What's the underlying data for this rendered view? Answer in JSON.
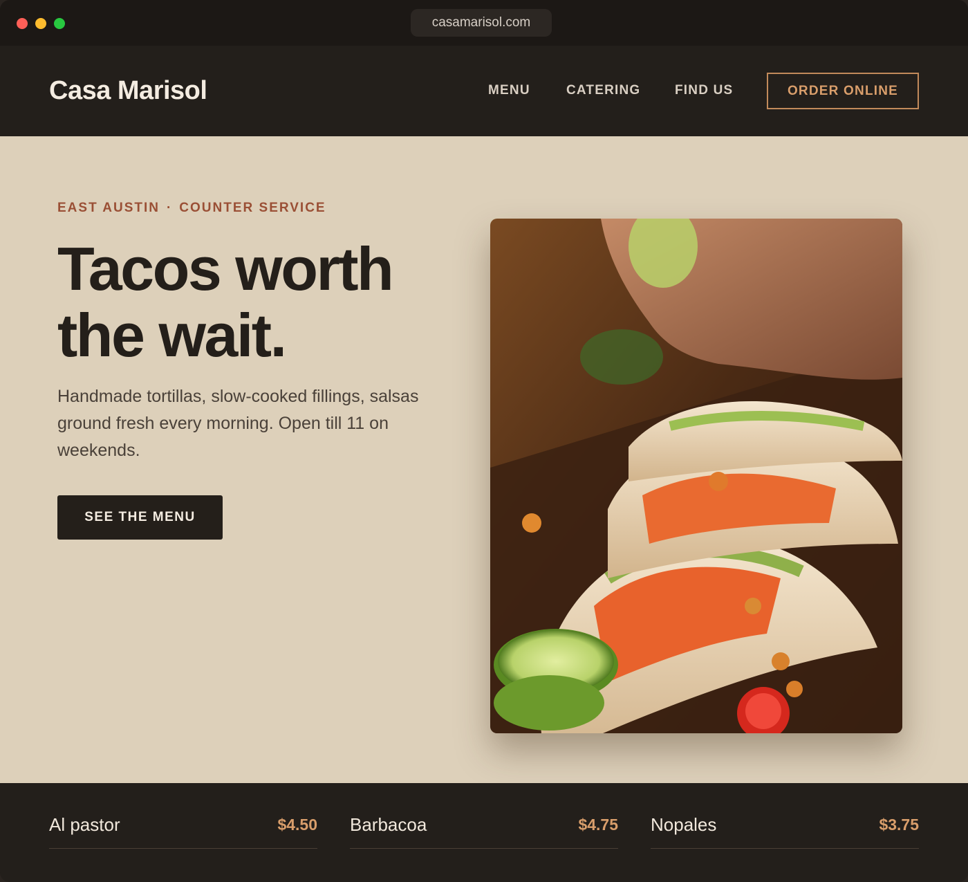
{
  "browser": {
    "url": "casamarisol.com"
  },
  "header": {
    "brand": "Casa Marisol",
    "nav": {
      "menu": "MENU",
      "catering": "CATERING",
      "find_us": "FIND US"
    },
    "order_button": "ORDER ONLINE"
  },
  "hero": {
    "eyebrow_location": "EAST AUSTIN",
    "eyebrow_separator": "·",
    "eyebrow_service": "COUNTER SERVICE",
    "headline_line1": "Tacos worth",
    "headline_line2": "the wait.",
    "lede": "Handmade tortillas, slow-cooked fillings, salsas ground fresh every morning. Open till 11 on weekends.",
    "cta": "SEE THE MENU"
  },
  "menu_items": [
    {
      "name": "Al pastor",
      "price": "$4.50"
    },
    {
      "name": "Barbacoa",
      "price": "$4.75"
    },
    {
      "name": "Nopales",
      "price": "$3.75"
    }
  ],
  "colors": {
    "page_background": "#ddd0ba",
    "header_background": "#231f1b",
    "accent": "#d99e6b",
    "eyebrow": "#9a4f35",
    "text_dark": "#241f1a"
  }
}
